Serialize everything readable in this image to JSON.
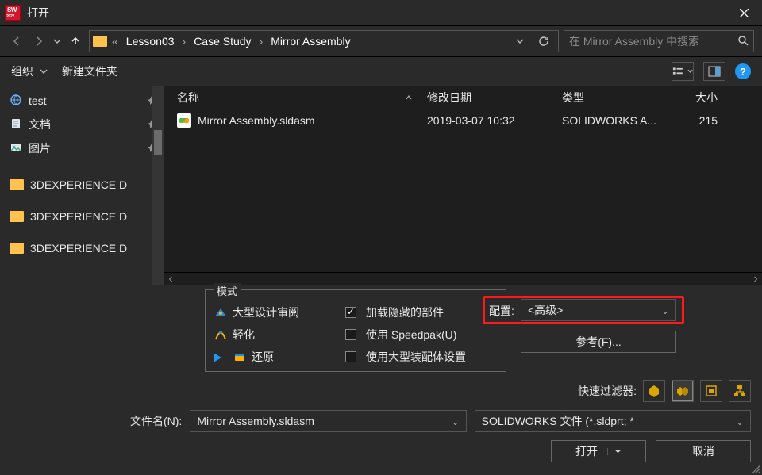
{
  "title": "打开",
  "breadcrumb": {
    "prefix": "«",
    "items": [
      "Lesson03",
      "Case Study",
      "Mirror Assembly"
    ]
  },
  "search": {
    "placeholder": "在 Mirror Assembly 中搜索"
  },
  "toolbar": {
    "organize": "组织",
    "newfolder": "新建文件夹"
  },
  "sidebar": {
    "items": [
      {
        "icon": "globe",
        "label": "test",
        "pinned": true
      },
      {
        "icon": "doc",
        "label": "文档",
        "pinned": true
      },
      {
        "icon": "pic",
        "label": "图片",
        "pinned": true
      }
    ],
    "items2": [
      {
        "label": "3DEXPERIENCE D"
      },
      {
        "label": "3DEXPERIENCE D"
      },
      {
        "label": "3DEXPERIENCE D"
      }
    ]
  },
  "columns": {
    "name": "名称",
    "date": "修改日期",
    "type": "类型",
    "size": "大小"
  },
  "rows": [
    {
      "name": "Mirror Assembly.sldasm",
      "date": "2019-03-07 10:32",
      "type": "SOLIDWORKS A...",
      "size": "215"
    }
  ],
  "mode": {
    "legend": "模式",
    "opts": [
      "大型设计审阅",
      "轻化",
      "还原"
    ],
    "checks": [
      {
        "label": "加载隐藏的部件",
        "checked": true
      },
      {
        "label": "使用 Speedpak(U)",
        "checked": false
      },
      {
        "label": "使用大型装配体设置",
        "checked": false
      }
    ]
  },
  "config": {
    "label": "配置:",
    "value": "<高级>",
    "ref_btn": "参考(F)..."
  },
  "quickfilter": {
    "label": "快速过滤器:"
  },
  "filename": {
    "label": "文件名(N):",
    "value": "Mirror Assembly.sldasm",
    "filter": "SOLIDWORKS 文件 (*.sldprt; *"
  },
  "actions": {
    "open": "打开",
    "cancel": "取消"
  }
}
